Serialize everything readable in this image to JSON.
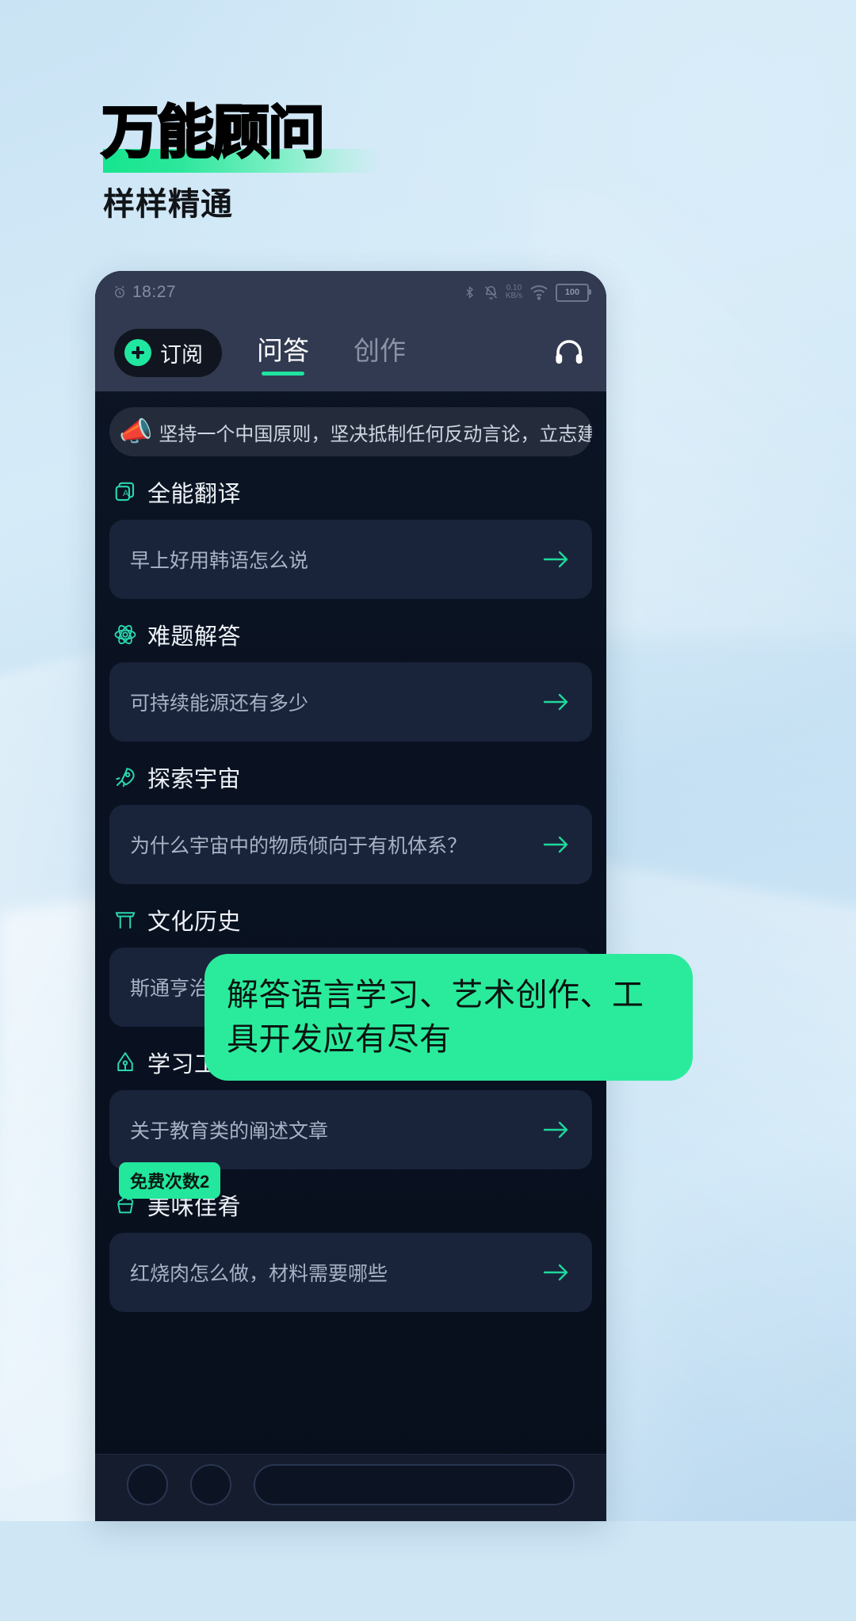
{
  "promo": {
    "headline": "万能顾问",
    "subhead": "样样精通",
    "callout": "解答语言学习、艺术创作、工具开发应有尽有",
    "accent_green": "#1fe7a0",
    "highlight_green": "#16e58e",
    "background_blue": "#cfe6f5"
  },
  "phone": {
    "statusbar": {
      "time": "18:27",
      "alarm_icon": "alarm-icon",
      "bluetooth_icon": "bluetooth-icon",
      "mute_icon": "mute-icon",
      "speed_value": "0.10",
      "speed_unit": "KB/s",
      "wifi_icon": "wifi-icon",
      "battery_level": "100"
    },
    "appbar": {
      "subscribe_label": "订阅",
      "subscribe_plus_icon": "plus-circle-icon",
      "headset_icon": "headset-icon",
      "tabs": [
        {
          "label": "问答",
          "active": true
        },
        {
          "label": "创作",
          "active": false
        }
      ]
    },
    "notice": {
      "emoji": "📣",
      "text": "坚持一个中国原则，坚决抵制任何反动言论，立志建"
    },
    "free_badge": "免费次数2",
    "sections": [
      {
        "icon": "translate-card-icon",
        "title": "全能翻译",
        "question": "早上好用韩语怎么说",
        "arrow_icon": "arrow-right-icon"
      },
      {
        "icon": "atom-icon",
        "title": "难题解答",
        "question": "可持续能源还有多少",
        "arrow_icon": "arrow-right-icon"
      },
      {
        "icon": "rocket-icon",
        "title": "探索宇宙",
        "question": "为什么宇宙中的物质倾向于有机体系？",
        "arrow_icon": "arrow-right-icon"
      },
      {
        "icon": "torii-gate-icon",
        "title": "文化历史",
        "question": "斯通亨治文明为何突然消失？",
        "arrow_icon": "arrow-right-icon"
      },
      {
        "icon": "pen-nib-icon",
        "title": "学习工作",
        "question": "关于教育类的阐述文章",
        "arrow_icon": "arrow-right-icon"
      },
      {
        "icon": "cupcake-icon",
        "title": "美味佳肴",
        "question": "红烧肉怎么做，材料需要哪些",
        "arrow_icon": "arrow-right-icon"
      }
    ],
    "bottombar": {
      "left_icon": "menu-circle-icon",
      "second_icon": "history-circle-icon",
      "input_placeholder": ""
    }
  }
}
